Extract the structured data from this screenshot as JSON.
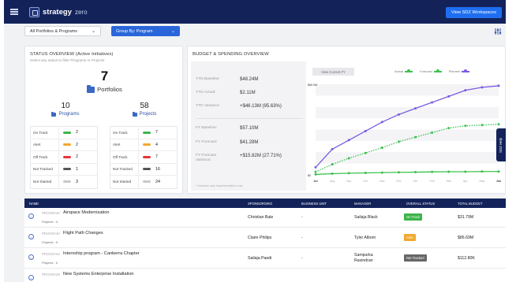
{
  "app": {
    "logo_text": "strategy",
    "logo_sub": "zero",
    "workspace_button": "View SDZ Workspaces"
  },
  "filters": {
    "portfolio_select": "All Portfolios & Programs",
    "group_select": "Group By: Program"
  },
  "status_overview": {
    "title": "STATUS OVERVIEW (Active Initiatives)",
    "subtitle": "Select any status to filter Programs or Projects",
    "portfolios_count": "7",
    "portfolios_label": "Portfolios",
    "programs_count": "10",
    "programs_label": "Programs",
    "projects_count": "58",
    "projects_label": "Projects",
    "programs_rows": [
      {
        "label": "On Track",
        "color": "#3cb54a",
        "value": "2"
      },
      {
        "label": "Alert",
        "color": "#f0a830",
        "value": "2"
      },
      {
        "label": "Off Track",
        "color": "#e8333a",
        "value": "2"
      },
      {
        "label": "Not Tracked",
        "color": "#555555",
        "value": "1"
      },
      {
        "label": "Not Started",
        "color": "#c8c8c8",
        "value": "3"
      }
    ],
    "projects_rows": [
      {
        "label": "On Track",
        "color": "#3cb54a",
        "value": "7"
      },
      {
        "label": "Alert",
        "color": "#f0a830",
        "value": "4"
      },
      {
        "label": "Off Track",
        "color": "#e8333a",
        "value": "7"
      },
      {
        "label": "Not Tracked",
        "color": "#555555",
        "value": "16"
      },
      {
        "label": "Not Started",
        "color": "#c8c8c8",
        "value": "24"
      }
    ]
  },
  "budget": {
    "title": "BUDGET & SPENDING OVERVIEW",
    "ytd_baseline_label": "YTD Baseline:",
    "ytd_baseline": "$48.24M",
    "ytd_actual_label": "YTD Actual:",
    "ytd_actual": "$2.11M",
    "ytd_variance_label": "YTD Variance:",
    "ytd_variance": "+$46.13M (95.63%)",
    "fy_baseline_label": "FY Baseline:",
    "fy_baseline": "$57.10M",
    "fy_forecast_label": "FY Forecast:",
    "fy_forecast": "$41.28M",
    "fy_variance_label": "FY Forecast Variance:",
    "fy_variance": "+$15.82M (27.71%)",
    "note": "* Includes only implementation cost",
    "view_button": "View Current FY",
    "help_tab": "SDZ Help"
  },
  "chart_data": {
    "type": "line",
    "categories": [
      "Jul",
      "Aug",
      "Sep",
      "Oct",
      "Nov",
      "Dec",
      "Jan",
      "Feb",
      "Mar",
      "Apr",
      "May",
      "Jun"
    ],
    "ytick_labels": [
      "$60.0M",
      "$0"
    ],
    "ylim": [
      0,
      60
    ],
    "series": [
      {
        "name": "Actual",
        "color": "#3cc24f",
        "style": "solid",
        "values": [
          0.3,
          0.8,
          1.1,
          1.3,
          1.5,
          1.7,
          1.8,
          2.0,
          2.1,
          2.1,
          2.2,
          2.2
        ]
      },
      {
        "name": "Forecast",
        "color": "#3cc24f",
        "style": "dashed",
        "values": [
          2,
          7,
          11,
          14.5,
          18,
          22,
          25,
          28,
          31,
          32.5,
          33,
          33.5
        ]
      },
      {
        "name": "Planned",
        "color": "#7b5ce0",
        "style": "solid",
        "values": [
          5,
          17,
          23,
          29,
          35,
          40,
          44,
          48,
          52,
          56,
          58,
          59
        ]
      }
    ]
  },
  "table": {
    "headers": [
      "NAME",
      "SPONSOR/SRO",
      "BUSINESS UNIT",
      "MANAGER",
      "OVERALL STATUS",
      "TOTAL BUDGET"
    ],
    "rows": [
      {
        "type": "PROGRAM",
        "name": "Airspace Modernisation",
        "sub": "Projects : 4",
        "sponsor": "Christian Bale",
        "unit": "-",
        "manager": "Sailaja Black",
        "status": "On Track",
        "status_color": "#3cb54a",
        "budget": "$31.79M"
      },
      {
        "type": "PROGRAM",
        "name": "Flight Path Changes",
        "sub": "Projects : 5",
        "sponsor": "Claire Philips",
        "unit": "-",
        "manager": "Tyler Albom",
        "status": "Alert",
        "status_color": "#f0a830",
        "budget": "$86.69M"
      },
      {
        "type": "PROGRAM",
        "name": "Internship program - Canberra Chapter",
        "sub": "Projects : 0",
        "sponsor": "Sailaja Paedi",
        "unit": "-",
        "manager": "Sampurka Ravindran",
        "status": "Not Tracked",
        "status_color": "#666666",
        "budget": "$112.80K"
      },
      {
        "type": "PROGRAM",
        "name": "New Systems Enterprise Installation",
        "sub": "",
        "sponsor": "",
        "unit": "",
        "manager": "",
        "status": "",
        "status_color": "#ffffff",
        "budget": ""
      }
    ]
  }
}
